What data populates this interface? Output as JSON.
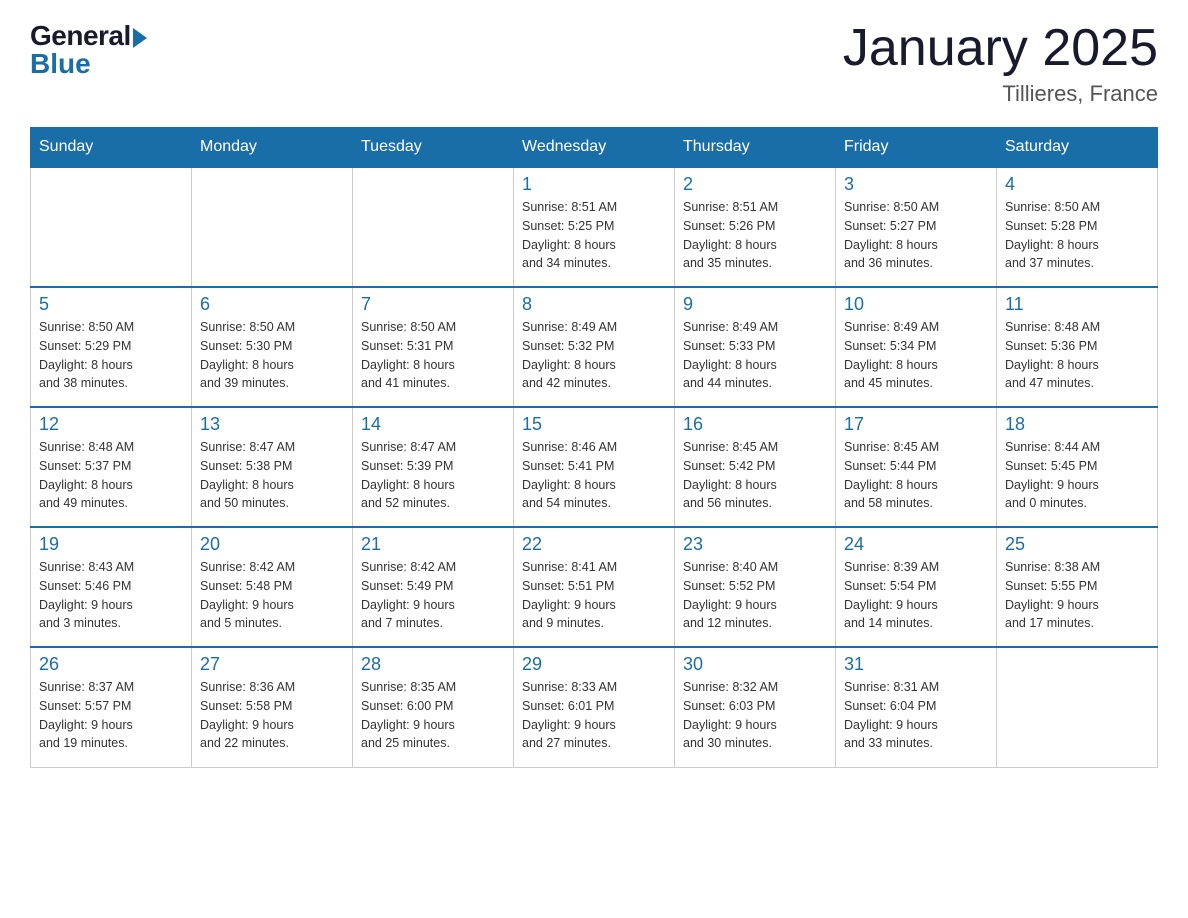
{
  "logo": {
    "general": "General",
    "blue": "Blue"
  },
  "title": "January 2025",
  "subtitle": "Tillieres, France",
  "days_of_week": [
    "Sunday",
    "Monday",
    "Tuesday",
    "Wednesday",
    "Thursday",
    "Friday",
    "Saturday"
  ],
  "weeks": [
    [
      {
        "day": "",
        "info": ""
      },
      {
        "day": "",
        "info": ""
      },
      {
        "day": "",
        "info": ""
      },
      {
        "day": "1",
        "info": "Sunrise: 8:51 AM\nSunset: 5:25 PM\nDaylight: 8 hours\nand 34 minutes."
      },
      {
        "day": "2",
        "info": "Sunrise: 8:51 AM\nSunset: 5:26 PM\nDaylight: 8 hours\nand 35 minutes."
      },
      {
        "day": "3",
        "info": "Sunrise: 8:50 AM\nSunset: 5:27 PM\nDaylight: 8 hours\nand 36 minutes."
      },
      {
        "day": "4",
        "info": "Sunrise: 8:50 AM\nSunset: 5:28 PM\nDaylight: 8 hours\nand 37 minutes."
      }
    ],
    [
      {
        "day": "5",
        "info": "Sunrise: 8:50 AM\nSunset: 5:29 PM\nDaylight: 8 hours\nand 38 minutes."
      },
      {
        "day": "6",
        "info": "Sunrise: 8:50 AM\nSunset: 5:30 PM\nDaylight: 8 hours\nand 39 minutes."
      },
      {
        "day": "7",
        "info": "Sunrise: 8:50 AM\nSunset: 5:31 PM\nDaylight: 8 hours\nand 41 minutes."
      },
      {
        "day": "8",
        "info": "Sunrise: 8:49 AM\nSunset: 5:32 PM\nDaylight: 8 hours\nand 42 minutes."
      },
      {
        "day": "9",
        "info": "Sunrise: 8:49 AM\nSunset: 5:33 PM\nDaylight: 8 hours\nand 44 minutes."
      },
      {
        "day": "10",
        "info": "Sunrise: 8:49 AM\nSunset: 5:34 PM\nDaylight: 8 hours\nand 45 minutes."
      },
      {
        "day": "11",
        "info": "Sunrise: 8:48 AM\nSunset: 5:36 PM\nDaylight: 8 hours\nand 47 minutes."
      }
    ],
    [
      {
        "day": "12",
        "info": "Sunrise: 8:48 AM\nSunset: 5:37 PM\nDaylight: 8 hours\nand 49 minutes."
      },
      {
        "day": "13",
        "info": "Sunrise: 8:47 AM\nSunset: 5:38 PM\nDaylight: 8 hours\nand 50 minutes."
      },
      {
        "day": "14",
        "info": "Sunrise: 8:47 AM\nSunset: 5:39 PM\nDaylight: 8 hours\nand 52 minutes."
      },
      {
        "day": "15",
        "info": "Sunrise: 8:46 AM\nSunset: 5:41 PM\nDaylight: 8 hours\nand 54 minutes."
      },
      {
        "day": "16",
        "info": "Sunrise: 8:45 AM\nSunset: 5:42 PM\nDaylight: 8 hours\nand 56 minutes."
      },
      {
        "day": "17",
        "info": "Sunrise: 8:45 AM\nSunset: 5:44 PM\nDaylight: 8 hours\nand 58 minutes."
      },
      {
        "day": "18",
        "info": "Sunrise: 8:44 AM\nSunset: 5:45 PM\nDaylight: 9 hours\nand 0 minutes."
      }
    ],
    [
      {
        "day": "19",
        "info": "Sunrise: 8:43 AM\nSunset: 5:46 PM\nDaylight: 9 hours\nand 3 minutes."
      },
      {
        "day": "20",
        "info": "Sunrise: 8:42 AM\nSunset: 5:48 PM\nDaylight: 9 hours\nand 5 minutes."
      },
      {
        "day": "21",
        "info": "Sunrise: 8:42 AM\nSunset: 5:49 PM\nDaylight: 9 hours\nand 7 minutes."
      },
      {
        "day": "22",
        "info": "Sunrise: 8:41 AM\nSunset: 5:51 PM\nDaylight: 9 hours\nand 9 minutes."
      },
      {
        "day": "23",
        "info": "Sunrise: 8:40 AM\nSunset: 5:52 PM\nDaylight: 9 hours\nand 12 minutes."
      },
      {
        "day": "24",
        "info": "Sunrise: 8:39 AM\nSunset: 5:54 PM\nDaylight: 9 hours\nand 14 minutes."
      },
      {
        "day": "25",
        "info": "Sunrise: 8:38 AM\nSunset: 5:55 PM\nDaylight: 9 hours\nand 17 minutes."
      }
    ],
    [
      {
        "day": "26",
        "info": "Sunrise: 8:37 AM\nSunset: 5:57 PM\nDaylight: 9 hours\nand 19 minutes."
      },
      {
        "day": "27",
        "info": "Sunrise: 8:36 AM\nSunset: 5:58 PM\nDaylight: 9 hours\nand 22 minutes."
      },
      {
        "day": "28",
        "info": "Sunrise: 8:35 AM\nSunset: 6:00 PM\nDaylight: 9 hours\nand 25 minutes."
      },
      {
        "day": "29",
        "info": "Sunrise: 8:33 AM\nSunset: 6:01 PM\nDaylight: 9 hours\nand 27 minutes."
      },
      {
        "day": "30",
        "info": "Sunrise: 8:32 AM\nSunset: 6:03 PM\nDaylight: 9 hours\nand 30 minutes."
      },
      {
        "day": "31",
        "info": "Sunrise: 8:31 AM\nSunset: 6:04 PM\nDaylight: 9 hours\nand 33 minutes."
      },
      {
        "day": "",
        "info": ""
      }
    ]
  ]
}
